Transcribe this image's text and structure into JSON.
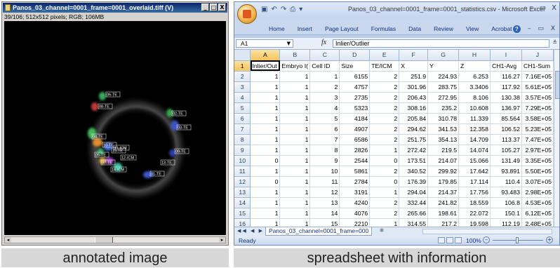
{
  "image_window": {
    "title": "Panos_03_channel=0001_frame=0001_overlaid.tiff (V)",
    "info": "39/106; 512x512 pixels; RGB; 106MB",
    "buttons": [
      "_",
      "□",
      "X"
    ],
    "cell_labels": [
      "06-TE",
      "08-TE",
      "02-TE",
      "03-TE",
      "04-TE",
      "10-TE",
      "15-TE",
      "05-TE",
      "07-TE",
      "01-TE",
      "11-ICM",
      "12-ICM",
      "14-ICM",
      "13-TE",
      "09-TE"
    ]
  },
  "excel": {
    "title": "Panos_03_channel=0001_frame=0001_statistics.csv - Microsoft Excel",
    "window_controls": [
      "–",
      "▭",
      "X"
    ],
    "ribbon_tabs": [
      "Home",
      "Insert",
      "Page Layout",
      "Formulas",
      "Data",
      "Review",
      "View",
      "Acrobat"
    ],
    "ribbon_right": [
      "?",
      "–",
      "▭",
      "X"
    ],
    "name_box": "A1",
    "fx": "fx",
    "formula": "Inlier/Outlier",
    "columns": [
      "A",
      "B",
      "C",
      "D",
      "E",
      "F",
      "G",
      "H",
      "I",
      "J"
    ],
    "header_row": [
      "Inlier/Out",
      "Embryo I(",
      "Cell ID",
      "Size",
      "TE/ICM",
      "X",
      "Y",
      "Z",
      "CH1-Avg",
      "CH1-Sum"
    ],
    "rows": [
      [
        "1",
        "1",
        "1",
        "6155",
        "2",
        "251.9",
        "224.93",
        "6.253",
        "116.27",
        "7.16E+05"
      ],
      [
        "1",
        "1",
        "2",
        "4757",
        "2",
        "301.96",
        "283.75",
        "3.3406",
        "117.92",
        "5.61E+05"
      ],
      [
        "1",
        "1",
        "3",
        "2735",
        "2",
        "206.43",
        "272.95",
        "8.106",
        "130.38",
        "3.57E+05"
      ],
      [
        "1",
        "1",
        "4",
        "5323",
        "2",
        "308.16",
        "235.2",
        "10.608",
        "136.97",
        "7.29E+05"
      ],
      [
        "1",
        "1",
        "5",
        "4184",
        "2",
        "205.84",
        "310.78",
        "11.339",
        "85.564",
        "3.58E+05"
      ],
      [
        "1",
        "1",
        "6",
        "4907",
        "2",
        "294.62",
        "341.53",
        "12.358",
        "106.52",
        "5.23E+05"
      ],
      [
        "1",
        "1",
        "7",
        "6586",
        "2",
        "251.75",
        "354.13",
        "14.709",
        "113.37",
        "7.47E+05"
      ],
      [
        "1",
        "1",
        "8",
        "2826",
        "1",
        "272.42",
        "219.5",
        "14.074",
        "105.27",
        "2.97E+05"
      ],
      [
        "0",
        "1",
        "9",
        "2544",
        "0",
        "173.51",
        "214.07",
        "15.066",
        "131.49",
        "3.35E+05"
      ],
      [
        "1",
        "1",
        "10",
        "5861",
        "2",
        "340.52",
        "299.92",
        "17.642",
        "93.891",
        "5.50E+05"
      ],
      [
        "0",
        "1",
        "11",
        "2784",
        "0",
        "176.39",
        "179.85",
        "17.114",
        "110.4",
        "3.07E+05"
      ],
      [
        "1",
        "1",
        "12",
        "3191",
        "1",
        "294.04",
        "214.37",
        "17.756",
        "93.483",
        "2.98E+05"
      ],
      [
        "1",
        "1",
        "13",
        "4240",
        "2",
        "332.44",
        "241.82",
        "18.559",
        "106.8",
        "4.53E+05"
      ],
      [
        "1",
        "1",
        "14",
        "4076",
        "2",
        "265.66",
        "198.61",
        "22.072",
        "150.1",
        "6.12E+05"
      ],
      [
        "1",
        "1",
        "15",
        "2210",
        "1",
        "314.55",
        "217.2",
        "19.598",
        "112.19",
        "2.48E+05"
      ]
    ],
    "sheet_nav": "◀◀ ◀ ▶ ▶▶",
    "sheet_tab": "Panos_03_channel=0001_frame=000",
    "status": "Ready",
    "zoom": "100%",
    "zoom_minus": "–",
    "zoom_plus": "+"
  },
  "captions": {
    "left": "annotated image",
    "right": "spreadsheet with information"
  }
}
